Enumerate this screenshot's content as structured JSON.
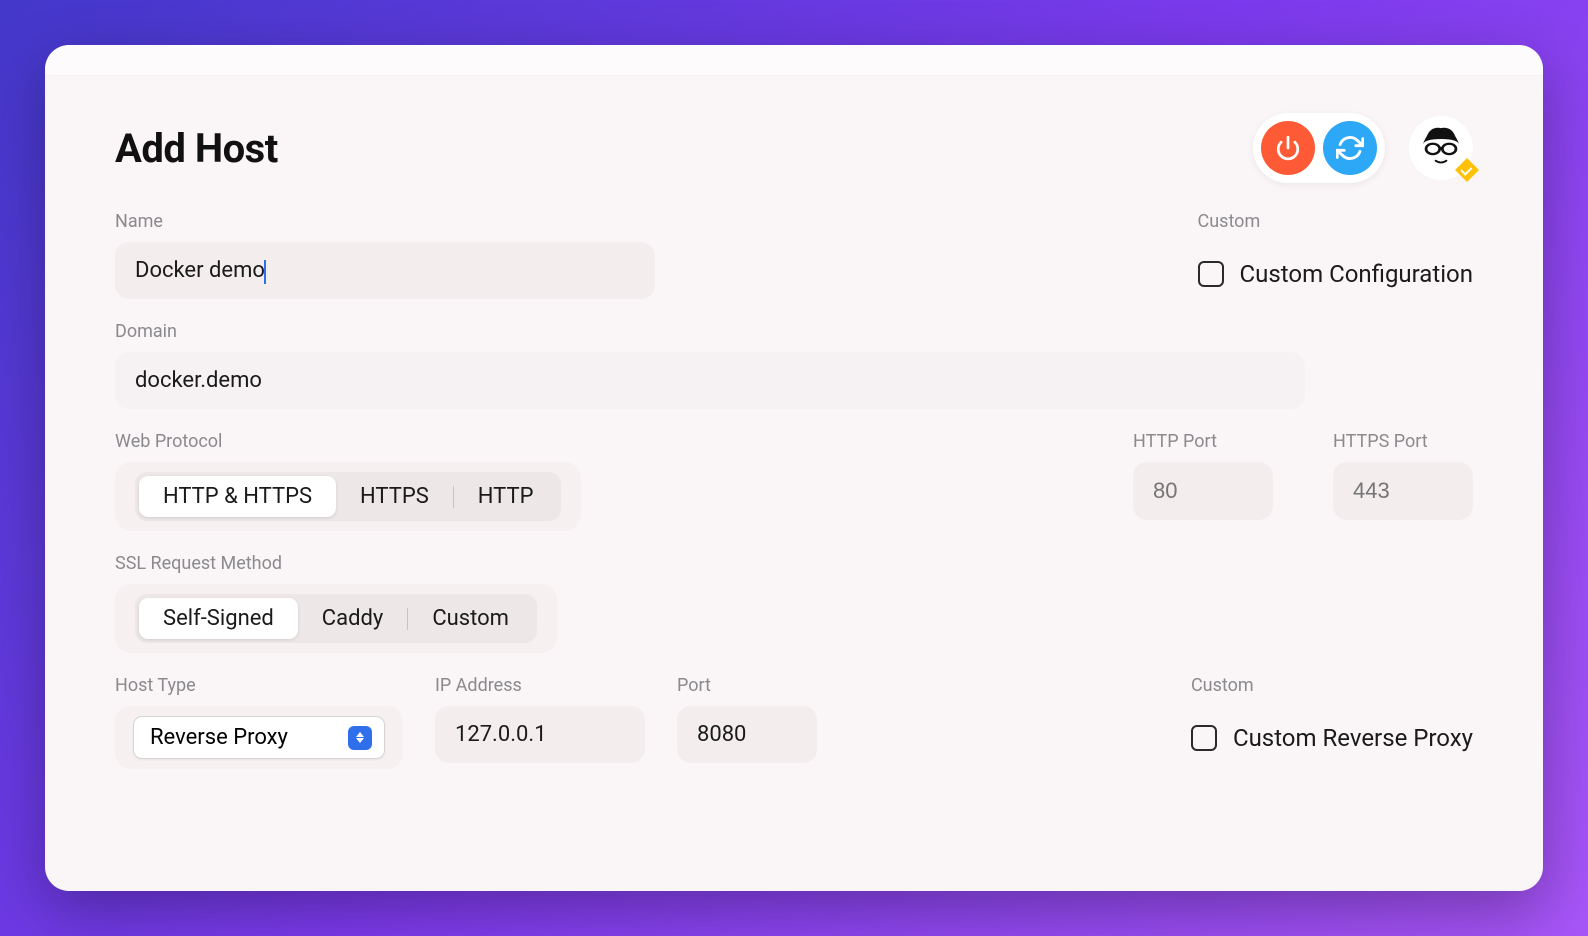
{
  "header": {
    "title": "Add Host"
  },
  "name": {
    "label": "Name",
    "value": "Docker demo"
  },
  "domain": {
    "label": "Domain",
    "value": "docker.demo"
  },
  "custom_config": {
    "section_label": "Custom",
    "checkbox_label": "Custom Configuration",
    "checked": false
  },
  "web_protocol": {
    "label": "Web Protocol",
    "options": [
      "HTTP & HTTPS",
      "HTTPS",
      "HTTP"
    ],
    "selected_index": 0
  },
  "http_port": {
    "label": "HTTP Port",
    "placeholder": "80"
  },
  "https_port": {
    "label": "HTTPS Port",
    "placeholder": "443"
  },
  "ssl_method": {
    "label": "SSL Request Method",
    "options": [
      "Self-Signed",
      "Caddy",
      "Custom"
    ],
    "selected_index": 0
  },
  "host_type": {
    "label": "Host Type",
    "selected": "Reverse Proxy"
  },
  "ip_address": {
    "label": "IP Address",
    "value": "127.0.0.1"
  },
  "port": {
    "label": "Port",
    "value": "8080"
  },
  "custom_reverse_proxy": {
    "section_label": "Custom",
    "checkbox_label": "Custom Reverse Proxy",
    "checked": false
  }
}
